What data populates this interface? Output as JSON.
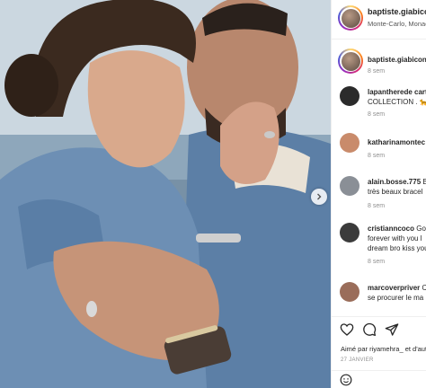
{
  "post": {
    "username": "baptiste.giabiconi",
    "location": "Monte-Carlo, Monaco",
    "caption_time": "9 sem",
    "caption_user": "baptiste.giabiconi",
    "caption_time2": "8 sem",
    "liked_by": "Aimé par riyamehra_ et d'autres personnes",
    "date": "27 JANVIER"
  },
  "comments": [
    {
      "user": "lapantherede cartier",
      "text_inline": "",
      "line2": "COLLECTION . 🐆",
      "time": "8 sem",
      "avatar_color": "#2b2b2b"
    },
    {
      "user": "katharinamontec",
      "text_inline": "",
      "line2": "",
      "time": "8 sem",
      "avatar_color": "#c98b6b"
    },
    {
      "user": "alain.bosse.775",
      "text_inline": "B",
      "line2": "très beaux bracel",
      "time": "8 sem",
      "avatar_color": "#8a8f96"
    },
    {
      "user": "cristianncoco",
      "text_inline": "Go",
      "line2": "forever with you l",
      "line3": "dream bro kiss you",
      "time": "8 sem",
      "avatar_color": "#3b3b3b"
    },
    {
      "user": "marcoverpriver",
      "text_inline": "C",
      "line2": "se procurer le ma",
      "time": "",
      "avatar_color": "#9a6d5a"
    }
  ],
  "icons": {
    "like": "heart-icon",
    "comment": "comment-icon",
    "share": "share-icon",
    "next": "chevron-right-icon",
    "emoji": "emoji-icon"
  },
  "colors": {
    "accent": "#3897f0",
    "text": "#262626",
    "muted": "#8e8e8e"
  }
}
